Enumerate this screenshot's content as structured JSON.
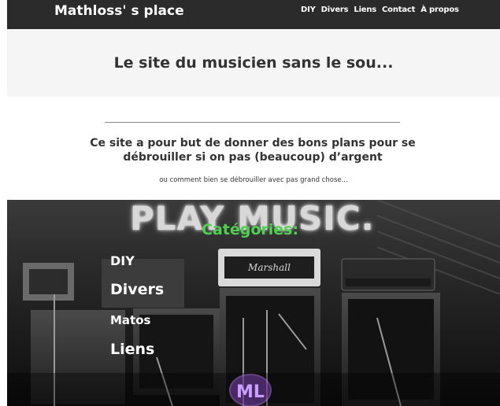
{
  "navbar": {
    "brand": "Mathloss' s place",
    "links": [
      "DIY",
      "Divers",
      "Liens",
      "Contact",
      "À propos"
    ]
  },
  "hero": {
    "title": "Le site du musicien sans le sou..."
  },
  "intro": {
    "heading": "Ce site a pour but de donner des bons plans pour se débrouiller si on pas (beaucoup) d’argent",
    "subtext": "ou comment bien se débrouiller avec pas grand chose..."
  },
  "music_section": {
    "banner_text": "PLAY MUSIC.",
    "categories_title": "Catégories:",
    "categories": [
      "DIY",
      "Divers",
      "Matos",
      "Liens"
    ],
    "logo_text": "ML"
  },
  "colors": {
    "navbar_bg": "#2b2b2b",
    "hero_bg": "#f5f5f5",
    "categories_accent": "#4fd14f",
    "logo_accent": "#7b3fb0"
  }
}
